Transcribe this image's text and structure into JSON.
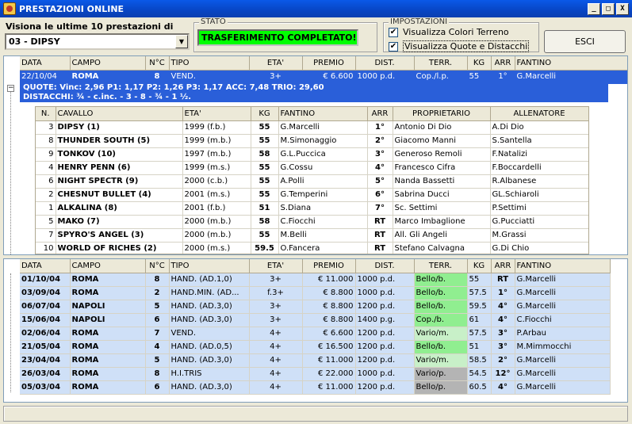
{
  "window": {
    "title": "PRESTAZIONI ONLINE",
    "min": "_",
    "max": "□",
    "close": "X"
  },
  "header": {
    "visiona_label": "Visiona le ultime 10 prestazioni di",
    "horse_selected": "03 - DIPSY",
    "stato_title": "STATO",
    "stato_value": "TRASFERIMENTO COMPLETATO!",
    "impostazioni_title": "IMPOSTAZIONI",
    "chk1": "Visualizza Colori Terreno",
    "chk2": "Visualizza Quote e Distacchi",
    "esci": "ESCI"
  },
  "race_columns": [
    "DATA",
    "CAMPO",
    "N°C",
    "TIPO",
    "ETA'",
    "PREMIO",
    "DIST.",
    "TERR.",
    "KG",
    "ARR",
    "FANTINO"
  ],
  "selected_race": {
    "data": "22/10/04",
    "campo": "ROMA",
    "nc": "8",
    "tipo": "VEND.",
    "eta": "3+",
    "premio": "€ 6.600",
    "dist": "1000 p.d.",
    "terr": "Cop./l.p.",
    "kg": "55",
    "arr": "1°",
    "fantino": "G.Marcelli"
  },
  "detail": {
    "quote": "QUOTE: Vinc: 2,96   P1: 1,17   P2: 1,26   P3: 1,17   ACC: 7,48   TRIO: 29,60",
    "distacchi": "DISTACCHI: ¾ - c.inc. - 3 - 8 - ¾ - 1 ½."
  },
  "runner_columns": [
    "N.",
    "CAVALLO",
    "ETA'",
    "KG",
    "FANTINO",
    "ARR",
    "PROPRIETARIO",
    "ALLENATORE"
  ],
  "runners": [
    {
      "n": "3",
      "cavallo": "DIPSY (1)",
      "eta": "1999 (f.b.)",
      "kg": "55",
      "fantino": "G.Marcelli",
      "arr": "1°",
      "prop": "Antonio Di Dio",
      "all": "A.Di Dio"
    },
    {
      "n": "8",
      "cavallo": "THUNDER SOUTH (5)",
      "eta": "1999 (m.b.)",
      "kg": "55",
      "fantino": "M.Simonaggio",
      "arr": "2°",
      "prop": "Giacomo Manni",
      "all": "S.Santella"
    },
    {
      "n": "9",
      "cavallo": "TONKOV (10)",
      "eta": "1997 (m.b.)",
      "kg": "58",
      "fantino": "G.L.Puccica",
      "arr": "3°",
      "prop": "Generoso Remoli",
      "all": "F.Natalizi"
    },
    {
      "n": "4",
      "cavallo": "HENRY PENN (6)",
      "eta": "1999 (m.s.)",
      "kg": "55",
      "fantino": "G.Cossu",
      "arr": "4°",
      "prop": "Francesco Cifra",
      "all": "F.Boccardelli"
    },
    {
      "n": "6",
      "cavallo": "NIGHT SPECTR (9)",
      "eta": "2000 (c.b.)",
      "kg": "55",
      "fantino": "A.Polli",
      "arr": "5°",
      "prop": "Nanda Bassetti",
      "all": "R.Albanese"
    },
    {
      "n": "2",
      "cavallo": "CHESNUT BULLET (4)",
      "eta": "2001 (m.s.)",
      "kg": "55",
      "fantino": "G.Temperini",
      "arr": "6°",
      "prop": "Sabrina Ducci",
      "all": "GL.Schiaroli"
    },
    {
      "n": "1",
      "cavallo": "ALKALINA (8)",
      "eta": "2001 (f.b.)",
      "kg": "51",
      "fantino": "S.Diana",
      "arr": "7°",
      "prop": "Sc. Settimi",
      "all": "P.Settimi"
    },
    {
      "n": "5",
      "cavallo": "MAKO (7)",
      "eta": "2000 (m.b.)",
      "kg": "58",
      "fantino": "C.Fiocchi",
      "arr": "RT",
      "prop": "Marco Imbaglione",
      "all": "G.Pucciatti"
    },
    {
      "n": "7",
      "cavallo": "SPYRO'S ANGEL (3)",
      "eta": "2000 (m.b.)",
      "kg": "55",
      "fantino": "M.Belli",
      "arr": "RT",
      "prop": "All. Gli Angeli",
      "all": "M.Grassi"
    },
    {
      "n": "10",
      "cavallo": "WORLD OF RICHES (2)",
      "eta": "2000 (m.s.)",
      "kg": "59.5",
      "fantino": "O.Fancera",
      "arr": "RT",
      "prop": "Stefano Calvagna",
      "all": "G.Di Chio"
    }
  ],
  "past_races": [
    {
      "data": "01/10/04",
      "campo": "ROMA",
      "nc": "8",
      "tipo": "HAND. (AD.1,0)",
      "eta": "3+",
      "premio": "€ 11.000",
      "dist": "1000 p.d.",
      "terr": "Bello/b.",
      "kg": "55",
      "arr": "RT",
      "fantino": "G.Marcelli",
      "tcolor": "#90ee90"
    },
    {
      "data": "03/09/04",
      "campo": "ROMA",
      "nc": "2",
      "tipo": "HAND.MIN. (AD...",
      "eta": "f.3+",
      "premio": "€ 8.800",
      "dist": "1000 p.d.",
      "terr": "Bello/b.",
      "kg": "57.5",
      "arr": "1°",
      "fantino": "G.Marcelli",
      "tcolor": "#90ee90"
    },
    {
      "data": "06/07/04",
      "campo": "NAPOLI",
      "nc": "5",
      "tipo": "HAND. (AD.3,0)",
      "eta": "3+",
      "premio": "€ 8.800",
      "dist": "1200 p.d.",
      "terr": "Bello/b.",
      "kg": "59.5",
      "arr": "4°",
      "fantino": "G.Marcelli",
      "tcolor": "#90ee90"
    },
    {
      "data": "15/06/04",
      "campo": "NAPOLI",
      "nc": "6",
      "tipo": "HAND. (AD.3,0)",
      "eta": "3+",
      "premio": "€ 8.800",
      "dist": "1400 p.g.",
      "terr": "Cop./b.",
      "kg": "61",
      "arr": "4°",
      "fantino": "C.Fiocchi",
      "tcolor": "#90ee90"
    },
    {
      "data": "02/06/04",
      "campo": "ROMA",
      "nc": "7",
      "tipo": "VEND.",
      "eta": "4+",
      "premio": "€ 6.600",
      "dist": "1200 p.d.",
      "terr": "Vario/m.",
      "kg": "57.5",
      "arr": "3°",
      "fantino": "P.Arbau",
      "tcolor": "#c8f0c8"
    },
    {
      "data": "21/05/04",
      "campo": "ROMA",
      "nc": "4",
      "tipo": "HAND. (AD.0,5)",
      "eta": "4+",
      "premio": "€ 16.500",
      "dist": "1200 p.d.",
      "terr": "Bello/b.",
      "kg": "51",
      "arr": "3°",
      "fantino": "M.Mimmocchi",
      "tcolor": "#90ee90"
    },
    {
      "data": "23/04/04",
      "campo": "ROMA",
      "nc": "5",
      "tipo": "HAND. (AD.3,0)",
      "eta": "4+",
      "premio": "€ 11.000",
      "dist": "1200 p.d.",
      "terr": "Vario/m.",
      "kg": "58.5",
      "arr": "2°",
      "fantino": "G.Marcelli",
      "tcolor": "#c8f0c8"
    },
    {
      "data": "26/03/04",
      "campo": "ROMA",
      "nc": "8",
      "tipo": "H.I.TRIS",
      "eta": "4+",
      "premio": "€ 22.000",
      "dist": "1000 p.d.",
      "terr": "Vario/p.",
      "kg": "54.5",
      "arr": "12°",
      "fantino": "G.Marcelli",
      "tcolor": "#b4b4b4"
    },
    {
      "data": "05/03/04",
      "campo": "ROMA",
      "nc": "6",
      "tipo": "HAND. (AD.3,0)",
      "eta": "4+",
      "premio": "€ 11.000",
      "dist": "1200 p.d.",
      "terr": "Bello/p.",
      "kg": "60.5",
      "arr": "4°",
      "fantino": "G.Marcelli",
      "tcolor": "#b4b4b4"
    }
  ]
}
